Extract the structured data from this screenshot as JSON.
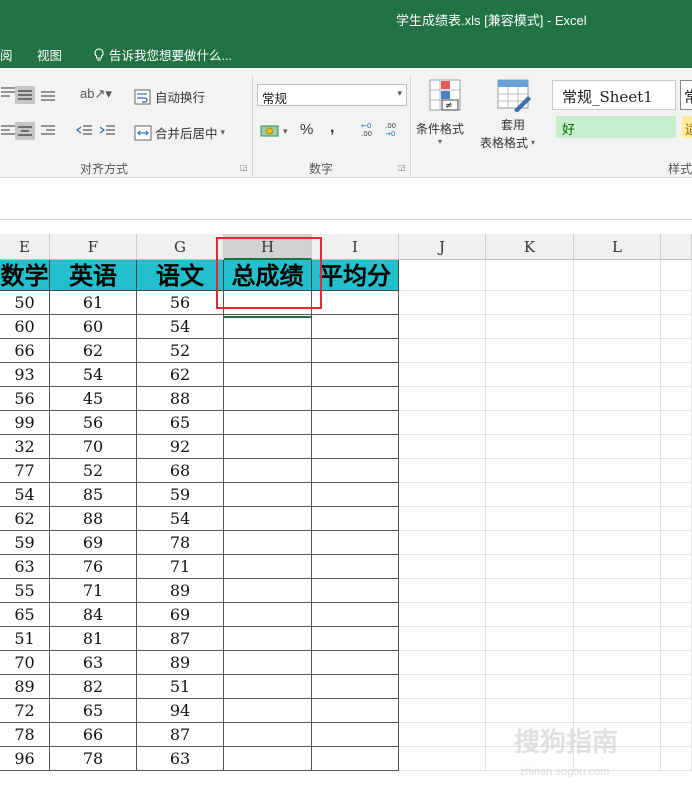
{
  "window": {
    "title": "学生成绩表.xls  [兼容模式] - Excel"
  },
  "menu": {
    "partial_tab": "阅",
    "view_tab": "视图",
    "tell_me": "告诉我您想要做什么..."
  },
  "ribbon": {
    "wrap_text": "自动换行",
    "merge_center": "合并后居中",
    "alignment_group": "对齐方式",
    "number_format": "常规",
    "percent": "%",
    "comma": ",",
    "number_group": "数字",
    "conditional_format": "条件格式",
    "format_table_line1": "套用",
    "format_table_line2": "表格格式",
    "styles_group": "样式",
    "style_normal": "常规_Sheet1",
    "style_normal2": "常",
    "style_good": "好",
    "style_neutral": "适"
  },
  "columns": [
    "E",
    "F",
    "G",
    "H",
    "I",
    "J",
    "K",
    "L"
  ],
  "table": {
    "headers": [
      "数学",
      "英语",
      "语文",
      "总成绩",
      "平均分"
    ],
    "rows": [
      [
        "50",
        "61",
        "56"
      ],
      [
        "60",
        "60",
        "54"
      ],
      [
        "66",
        "62",
        "52"
      ],
      [
        "93",
        "54",
        "62"
      ],
      [
        "56",
        "45",
        "88"
      ],
      [
        "99",
        "56",
        "65"
      ],
      [
        "32",
        "70",
        "92"
      ],
      [
        "77",
        "52",
        "68"
      ],
      [
        "54",
        "85",
        "59"
      ],
      [
        "62",
        "88",
        "54"
      ],
      [
        "59",
        "69",
        "78"
      ],
      [
        "63",
        "76",
        "71"
      ],
      [
        "55",
        "71",
        "89"
      ],
      [
        "65",
        "84",
        "69"
      ],
      [
        "51",
        "81",
        "87"
      ],
      [
        "70",
        "63",
        "89"
      ],
      [
        "89",
        "82",
        "51"
      ],
      [
        "72",
        "65",
        "94"
      ],
      [
        "78",
        "66",
        "87"
      ],
      [
        "96",
        "78",
        "63"
      ]
    ]
  },
  "watermark": {
    "main": "搜狗指南",
    "sub": "zhinan.sogou.com"
  },
  "colors": {
    "excel_green": "#217346",
    "header_fill": "#22c0cc",
    "highlight_box": "#e8282e"
  }
}
